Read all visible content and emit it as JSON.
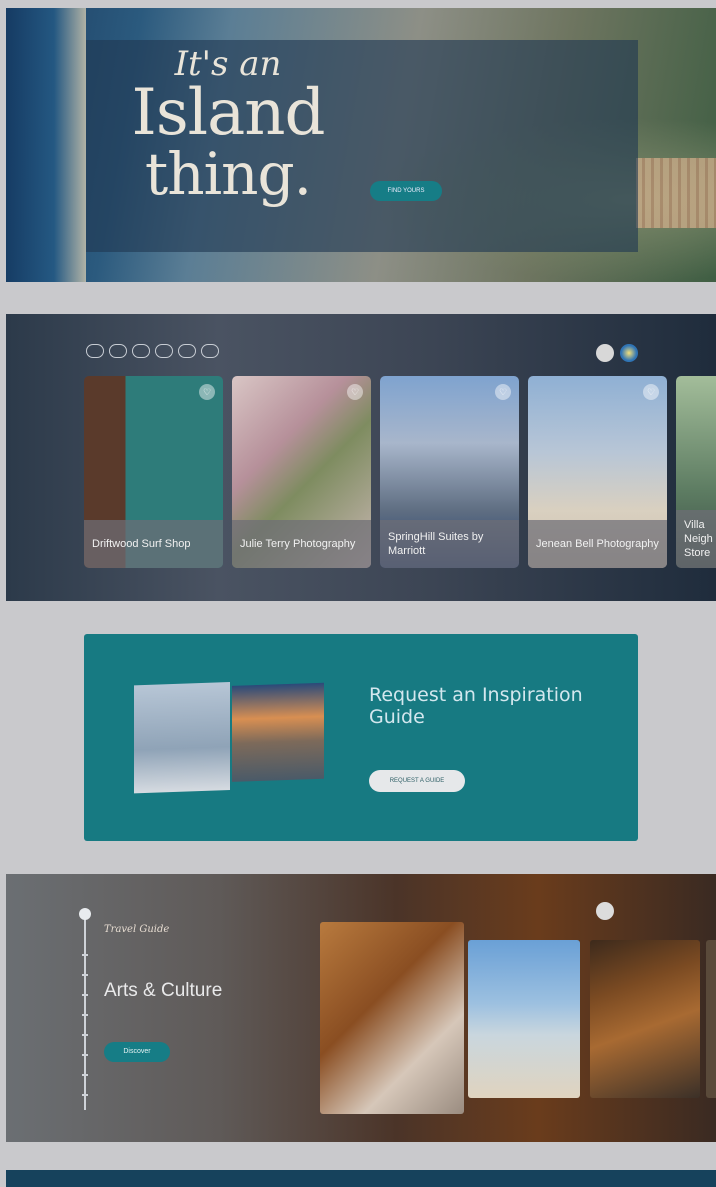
{
  "hero": {
    "headline_line1": "It's an",
    "headline_line2": "Island",
    "headline_line3": "thing.",
    "paragraph1": "",
    "paragraph2": "",
    "button_label": "FIND YOURS"
  },
  "listings": {
    "filter_chips": [
      "",
      "",
      "",
      "",
      "",
      ""
    ],
    "cards": [
      {
        "name": "Driftwood Surf Shop"
      },
      {
        "name": "Julie Terry Photography"
      },
      {
        "name": "SpringHill Suites by Marriott"
      },
      {
        "name": "Jenean Bell Photography"
      },
      {
        "name": "Villa Neigh Store"
      }
    ],
    "favorite_icon": "♡"
  },
  "guide": {
    "title": "Request an Inspiration Guide",
    "description": "",
    "button_label": "REQUEST A GUIDE"
  },
  "arts": {
    "kicker": "Travel Guide",
    "title": "Arts & Culture",
    "description": "",
    "button_label": "Discover"
  },
  "colors": {
    "teal": "#167d86",
    "guide_bg": "#177a82",
    "footer": "#16425c"
  }
}
